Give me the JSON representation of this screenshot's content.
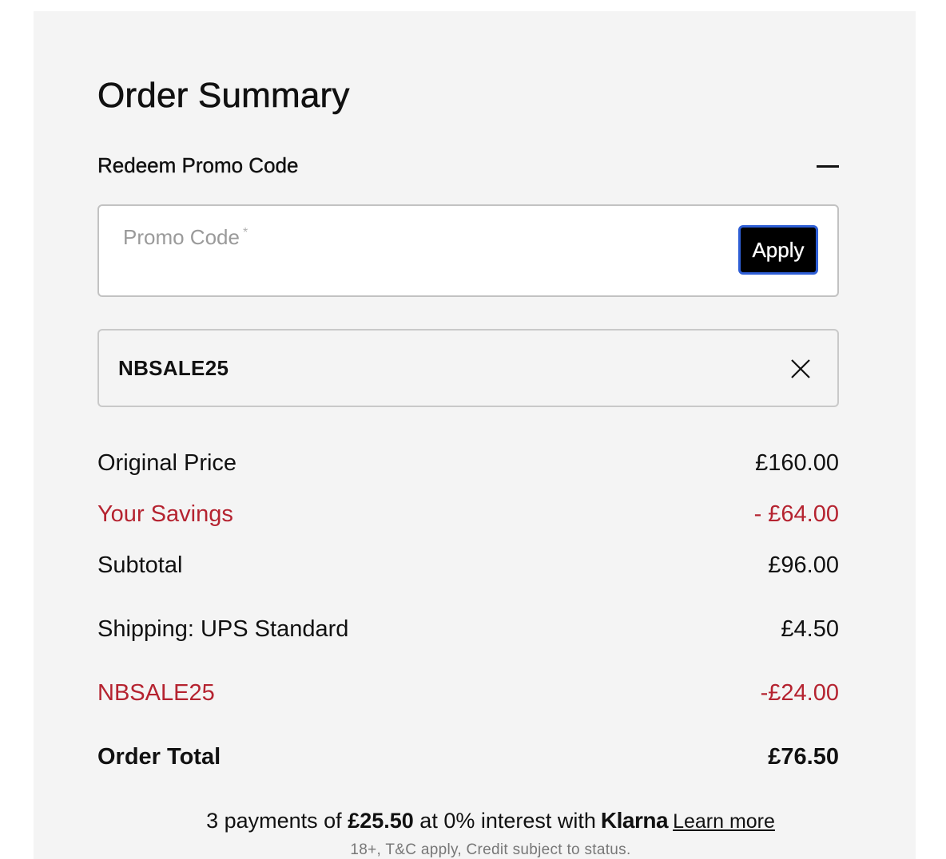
{
  "page_title": "Order Summary",
  "promo": {
    "header_label": "Redeem Promo Code",
    "toggle_icon": "minus-icon",
    "input_value": "",
    "input_placeholder": "Promo Code",
    "required_marker": "*",
    "apply_label": "Apply",
    "applied_code": "NBSALE25",
    "remove_icon": "close-icon"
  },
  "summary": {
    "original_price_label": "Original Price",
    "original_price_value": "£160.00",
    "savings_label": "Your Savings",
    "savings_value": "- £64.00",
    "subtotal_label": "Subtotal",
    "subtotal_value": "£96.00",
    "shipping_label": "Shipping: UPS Standard",
    "shipping_value": "£4.50",
    "discount_label": "NBSALE25",
    "discount_value": "-£24.00",
    "total_label": "Order Total",
    "total_value": "£76.50"
  },
  "klarna": {
    "prefix": "3 payments of",
    "amount": "£25.50",
    "middle": "at 0% interest with",
    "brand": "Klarna",
    "learn_more": "Learn more",
    "fine_print": "18+, T&C apply, Credit subject to status."
  },
  "colors": {
    "panel_bg": "#f4f4f4",
    "accent_red": "#b52330",
    "apply_bg": "#000000",
    "focus_ring": "#2f5fd6"
  }
}
